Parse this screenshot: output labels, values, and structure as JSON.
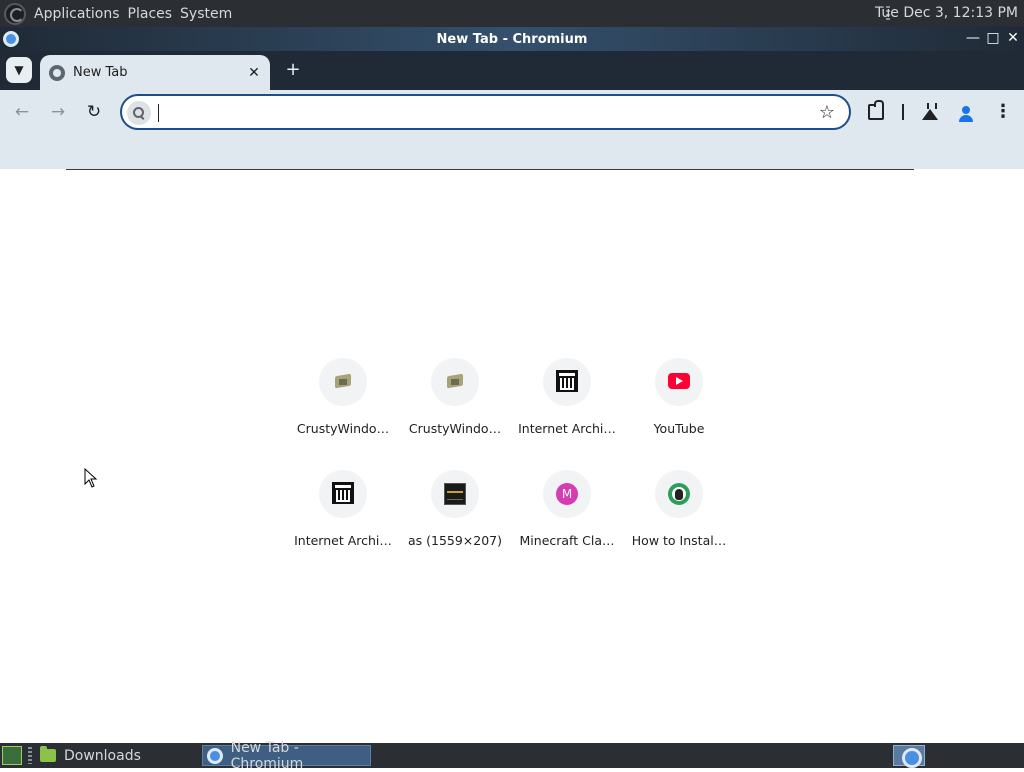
{
  "desktop_panel": {
    "menus": [
      "Applications",
      "Places",
      "System"
    ],
    "clock": "Tue Dec  3, 12:13 PM"
  },
  "window": {
    "title": "New Tab - Chromium",
    "controls": [
      "minimize",
      "maximize",
      "close"
    ]
  },
  "tabs": [
    {
      "title": "New Tab",
      "active": true
    }
  ],
  "toolbar": {
    "omnibox_value": "",
    "omnibox_placeholder": ""
  },
  "shortcuts": [
    {
      "label": "CrustyWindo…",
      "icon": "crusty-house-icon"
    },
    {
      "label": "CrustyWindo…",
      "icon": "crusty-house-icon"
    },
    {
      "label": "Internet Archi…",
      "icon": "internet-archive-icon"
    },
    {
      "label": "YouTube",
      "icon": "youtube-icon"
    },
    {
      "label": "Internet Archi…",
      "icon": "internet-archive-icon"
    },
    {
      "label": "as (1559×207)",
      "icon": "image-thumbnail-icon"
    },
    {
      "label": "Minecraft Cla…",
      "icon": "letter-m-icon",
      "icon_text": "M",
      "icon_color": "#d63cb3"
    },
    {
      "label": "How to Instal…",
      "icon": "linux-penguin-icon"
    }
  ],
  "taskbar": {
    "tasks": [
      {
        "label": "Downloads",
        "active": false
      },
      {
        "label": "New Tab - Chromium",
        "active": true
      }
    ]
  },
  "colors": {
    "accent": "#1b4f8a",
    "toolbar_bg": "#dfe8ee",
    "tabstrip_bg": "#1f2a36",
    "panel_bg": "#2b2e33"
  }
}
